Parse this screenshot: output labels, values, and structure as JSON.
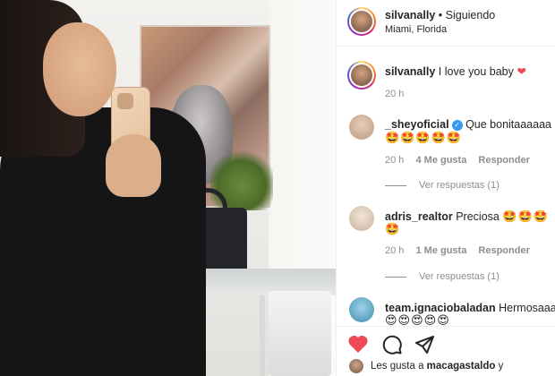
{
  "post": {
    "author": "silvanally",
    "follow_state": "• Siguiendo",
    "location": "Miami, Florida",
    "caption": "I love you baby",
    "caption_heart": "❤",
    "caption_time": "20 h"
  },
  "comments": [
    {
      "user": "_sheyoficial",
      "verified": true,
      "text": "Que bonitaaaaaa",
      "emojis": "🤩🤩🤩🤩🤩",
      "time": "20 h",
      "likes": "4 Me gusta",
      "reply_label": "Responder",
      "view_replies": "Ver respuestas (1)"
    },
    {
      "user": "adris_realtor",
      "verified": false,
      "text": "Preciosa",
      "emojis_inline": "🤩🤩🤩",
      "emojis": "🤩",
      "time": "20 h",
      "likes": "1 Me gusta",
      "reply_label": "Responder",
      "view_replies": "Ver respuestas (1)"
    },
    {
      "user": "team.ignaciobaladan",
      "verified": false,
      "text": "Hermosaaa",
      "emojis": "😍😍😍😍😍"
    }
  ],
  "footer": {
    "likes_text": "Les gusta a",
    "likes_user": "macagastaldo",
    "likes_suffix": "y"
  },
  "icons": {
    "like": "heart-icon",
    "comment": "comment-icon",
    "share": "share-icon"
  },
  "colors": {
    "like_active": "#ed4956",
    "muted": "#8e8e8e",
    "verified": "#3897f0"
  }
}
